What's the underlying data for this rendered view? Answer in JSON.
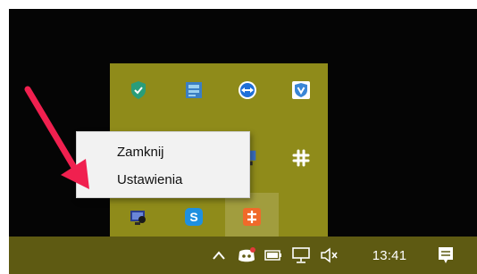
{
  "context_menu": {
    "items": [
      {
        "label": "Zamknij"
      },
      {
        "label": "Ustawienia"
      }
    ]
  },
  "tray_overflow": {
    "icons": [
      "shield-check-icon",
      "network-adapter-icon",
      "teamviewer-icon",
      "shield-v-icon",
      "slack-icon",
      "cable-network-icon",
      "skype-icon",
      "orange-app-icon"
    ],
    "skype_letter": "S"
  },
  "taskbar": {
    "clock": "13:41"
  },
  "colors": {
    "desktop": "#050505",
    "overflow_background": "#8f8b1a",
    "taskbar": "#5e5a12",
    "menu_background": "#f2f2f2",
    "arrow": "#f0204f"
  }
}
